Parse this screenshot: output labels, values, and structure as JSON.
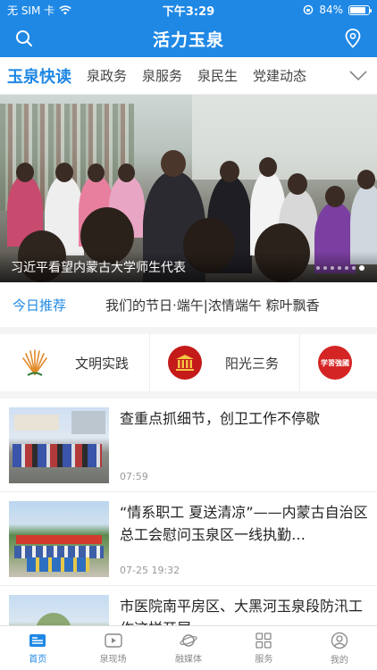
{
  "status": {
    "carrier": "无 SIM 卡",
    "time": "下午3:29",
    "battery": "84%",
    "battery_level": 0.84
  },
  "header": {
    "title": "活力玉泉",
    "left_icon": "search-icon",
    "right_icon": "location-pin-icon"
  },
  "tabs": [
    {
      "label": "玉泉快读",
      "active": true
    },
    {
      "label": "泉政务"
    },
    {
      "label": "泉服务"
    },
    {
      "label": "泉民生"
    },
    {
      "label": "党建动态"
    }
  ],
  "banner": {
    "caption": "习近平看望内蒙古大学师生代表",
    "slides": 7,
    "current": 6
  },
  "recommend": {
    "label": "今日推荐",
    "text": "我们的节日·端午|浓情端午 粽叶飘香"
  },
  "services": [
    {
      "name": "文明实践",
      "icon": "civilization-practice-logo"
    },
    {
      "name": "阳光三务",
      "icon": "sunshine-affairs-logo"
    },
    {
      "name": "",
      "icon": "study-strong-nation-logo",
      "logo_text": "学習強國"
    }
  ],
  "news": [
    {
      "title": "查重点抓细节，创卫工作不停歇",
      "time": "07:59"
    },
    {
      "title": "“情系职工 夏送清凉”——内蒙古自治区总工会慰问玉泉区一线执勤…",
      "time": "07-25 19:32"
    },
    {
      "title": "市医院南平房区、大黑河玉泉段防汛工作这样开展",
      "time": ""
    }
  ],
  "bottom_nav": [
    {
      "label": "首页",
      "icon": "home-news-icon",
      "active": true
    },
    {
      "label": "泉现场",
      "icon": "video-play-icon"
    },
    {
      "label": "融媒体",
      "icon": "planet-icon"
    },
    {
      "label": "服务",
      "icon": "grid-icon"
    },
    {
      "label": "我的",
      "icon": "user-icon"
    }
  ],
  "colors": {
    "brand": "#1f88e5"
  }
}
